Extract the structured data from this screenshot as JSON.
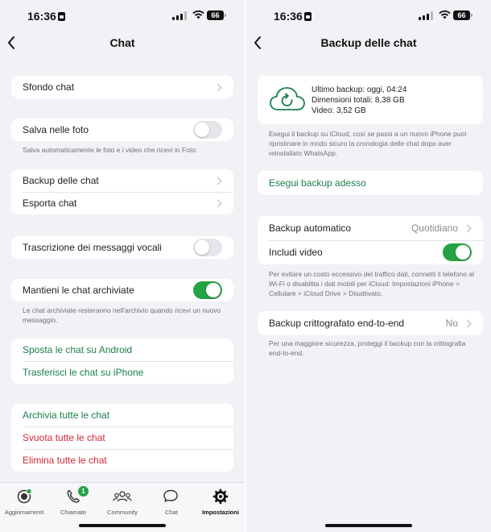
{
  "colors": {
    "accent_green": "#1a7f4a",
    "toggle_on": "#25a244",
    "destructive": "#d12b3a"
  },
  "status_bar": {
    "time": "16:36",
    "battery": "66"
  },
  "left": {
    "title": "Chat",
    "sfondo_label": "Sfondo chat",
    "salva_label": "Salva nelle foto",
    "salva_on": false,
    "salva_note": "Salva automaticamente le foto e i video che ricevi in Foto.",
    "backup_label": "Backup delle chat",
    "esporta_label": "Esporta chat",
    "trascrizione_label": "Trascrizione dei messaggi vocali",
    "trascrizione_on": false,
    "mantieni_label": "Mantieni le chat archiviate",
    "mantieni_on": true,
    "mantieni_note": "Le chat archiviate resteranno nell'archivio quando ricevi un nuovo messaggio.",
    "sposta_label": "Sposta le chat su Android",
    "trasferisci_label": "Trasferisci le chat su iPhone",
    "archivia_label": "Archivia tutte le chat",
    "svuota_label": "Svuota tutte le chat",
    "elimina_label": "Elimina tutte le chat"
  },
  "tabbar": {
    "tabs": [
      {
        "label": "Aggiornamenti",
        "icon": "updates-icon"
      },
      {
        "label": "Chiamate",
        "icon": "phone-icon",
        "badge": "1"
      },
      {
        "label": "Community",
        "icon": "community-icon"
      },
      {
        "label": "Chat",
        "icon": "chat-bubbles-icon"
      },
      {
        "label": "Impostazioni",
        "icon": "gear-icon",
        "active": true
      }
    ]
  },
  "right": {
    "title": "Backup delle chat",
    "last_backup": "Ultimo backup: oggi, 04:24",
    "total_size": "Dimensioni totali: 8,38 GB",
    "video_size": "Video: 3,52 GB",
    "backup_note": "Esegui il backup su iCloud, così se passi a un nuovo iPhone puoi ripristinare in modo sicuro la cronologia delle chat dopo aver reinstallato WhatsApp.",
    "esegui_label": "Esegui backup adesso",
    "auto_label": "Backup automatico",
    "auto_value": "Quotidiano",
    "includi_label": "Includi video",
    "includi_on": true,
    "data_note": "Per evitare un costo eccessivo del traffico dati, connetti il telefono al Wi-Fi o disabilita i dati mobili per iCloud: Impostazioni iPhone > Cellulare > iCloud Drive > Disattivato.",
    "e2e_label": "Backup crittografato end-to-end",
    "e2e_value": "No",
    "e2e_note": "Per una maggiore sicurezza, proteggi il backup con la crittografia end-to-end."
  }
}
